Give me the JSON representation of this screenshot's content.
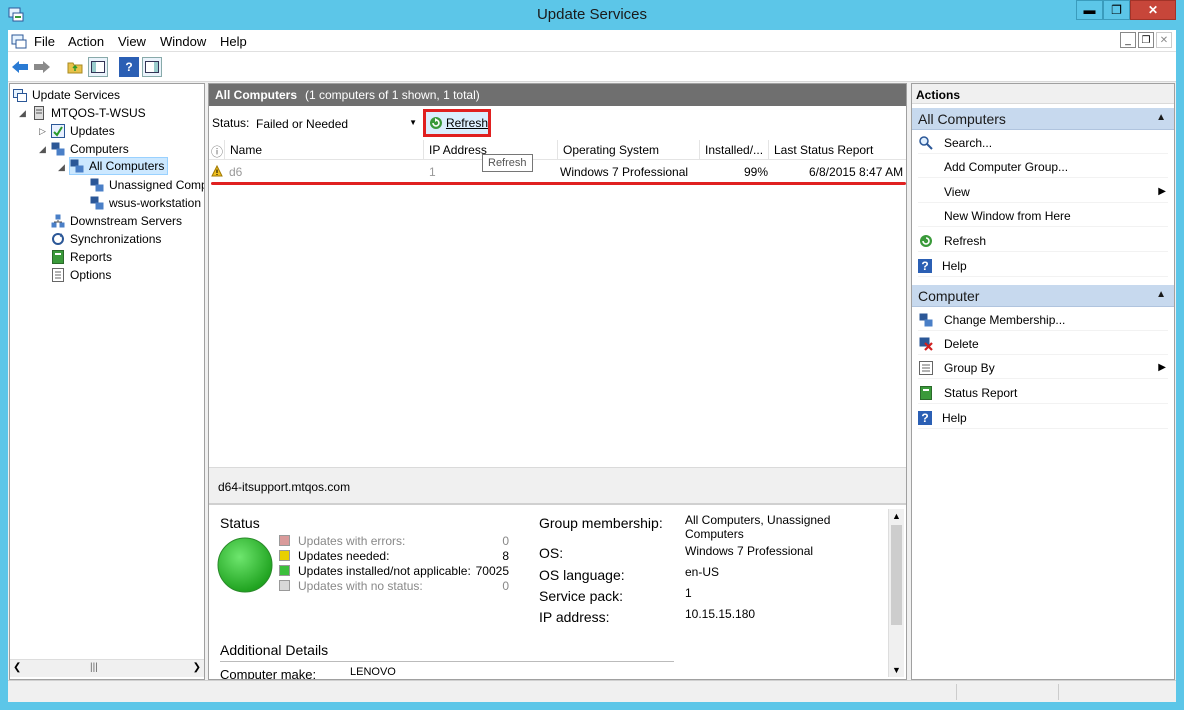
{
  "window": {
    "title": "Update Services",
    "minimize": "▬",
    "maximize": "❐",
    "close": "✕"
  },
  "menu": {
    "file": "File",
    "action": "Action",
    "view": "View",
    "window": "Window",
    "help": "Help"
  },
  "tree": {
    "root": "Update Services",
    "server": "MTQOS-T-WSUS",
    "updates": "Updates",
    "computers": "Computers",
    "all_computers": "All Computers",
    "unassigned": "Unassigned Comp",
    "wsus_workstation": "wsus-workstation",
    "downstream": "Downstream Servers",
    "synchronizations": "Synchronizations",
    "reports": "Reports",
    "options": "Options"
  },
  "center": {
    "title": "All Computers",
    "subtitle": "(1 computers of 1 shown, 1 total)",
    "status_label": "Status:",
    "status_value": "Failed or Needed",
    "refresh_label": "Refresh",
    "tooltip": "Refresh",
    "columns": {
      "name": "Name",
      "ip": "IP Address",
      "os": "Operating System",
      "installed": "Installed/...",
      "last_status": "Last Status Report"
    },
    "row": {
      "name": "d6",
      "ip": "1",
      "os": "Windows 7 Professional",
      "installed": "99%",
      "last_status": "6/8/2015 8:47 AM"
    },
    "hostname": "d64-itsupport.mtqos.com"
  },
  "detail": {
    "status_title": "Status",
    "legend": [
      {
        "label": "Updates with errors:",
        "value": "0",
        "color": "#d99a9a"
      },
      {
        "label": "Updates needed:",
        "value": "8",
        "color": "#e8d000"
      },
      {
        "label": "Updates installed/not applicable:",
        "value": "70025",
        "color": "#3cbf3c"
      },
      {
        "label": "Updates with no status:",
        "value": "0",
        "color": "#d8d8d8"
      }
    ],
    "group_label": "Group membership:",
    "group_value": "All Computers, Unassigned Computers",
    "os_label": "OS:",
    "os_value": "Windows 7 Professional",
    "lang_label": "OS language:",
    "lang_value": "en-US",
    "sp_label": "Service pack:",
    "sp_value": "1",
    "ip_label": "IP address:",
    "ip_value": "10.15.15.180",
    "additional": "Additional Details",
    "make_label": "Computer make:",
    "make_value": "LENOVO"
  },
  "actions": {
    "header": "Actions",
    "section1": "All Computers",
    "items1": [
      "Search...",
      "Add Computer Group...",
      "View",
      "New Window from Here",
      "Refresh",
      "Help"
    ],
    "section2": "Computer",
    "items2": [
      "Change Membership...",
      "Delete",
      "Group By",
      "Status Report",
      "Help"
    ]
  },
  "colors": {
    "titlebar": "#5cc6e8",
    "header": "#6f6f6f",
    "section": "#c7d9ee",
    "highlight": "#e02020"
  }
}
